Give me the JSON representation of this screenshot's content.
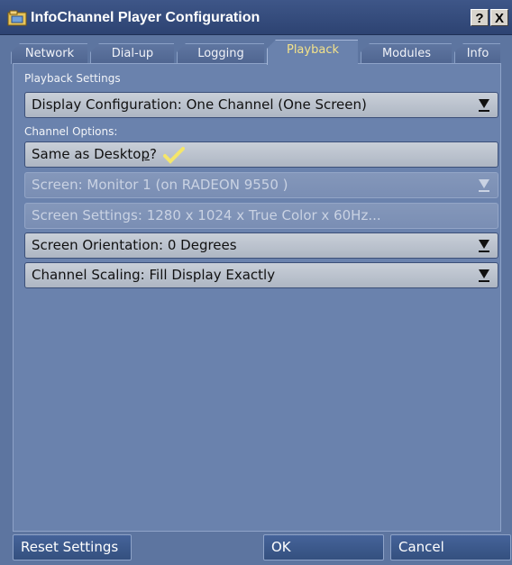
{
  "window": {
    "title": "InfoChannel Player Configuration",
    "help_label": "?",
    "close_label": "X"
  },
  "tabs": [
    {
      "label": "Network"
    },
    {
      "label": "Dial-up"
    },
    {
      "label": "Logging"
    },
    {
      "label": "Playback",
      "selected": true
    },
    {
      "label": "Modules"
    },
    {
      "label": "Info"
    }
  ],
  "playback": {
    "section_label": "Playback Settings",
    "display_configuration": {
      "label": "Display Configuration:",
      "value": "One Channel (One Screen)"
    },
    "channel_options_label": "Channel Options:",
    "same_as_desktop": {
      "label_before": "Same as Deskto",
      "label_ul": "p",
      "label_after": "?",
      "checked": true
    },
    "screen": {
      "label_before": "Screen: Monitor 1 (on RADEON 9550 )",
      "disabled": true
    },
    "screen_settings": {
      "label": "Screen Settings:",
      "value": "1280 x 1024 x True Color x 60Hz...",
      "disabled": true
    },
    "screen_orientation": {
      "label": "Screen Orientation:",
      "value": "0 Degrees"
    },
    "channel_scaling": {
      "label": "Channel Scaling:",
      "value": "Fill Display Exactly"
    }
  },
  "buttons": {
    "reset": "Reset Settings",
    "ok": "OK",
    "cancel": "Cancel"
  },
  "colors": {
    "panel": "#6a82ad",
    "active_tab_text": "#f3e28a",
    "check": "#f5e66a"
  }
}
